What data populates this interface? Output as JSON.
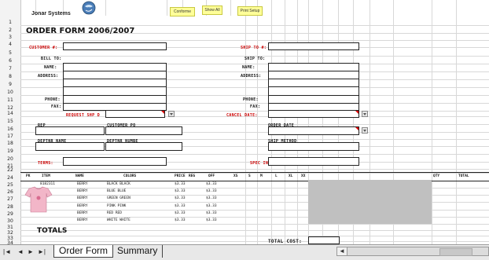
{
  "header": {
    "company": "Jonar Systems",
    "buttons": [
      "Conforme",
      "Show All",
      "Print Setup"
    ]
  },
  "title": "ORDER FORM 2006/2007",
  "row_numbers": [
    "1",
    "2",
    "3",
    "4",
    "5",
    "6",
    "7",
    "8",
    "9",
    "10",
    "11",
    "12",
    "14",
    "15",
    "16",
    "17",
    "18",
    "19",
    "20",
    "21",
    "22",
    "24",
    "25",
    "26",
    "27",
    "28",
    "29",
    "30",
    "31",
    "32",
    "33",
    "34",
    "35"
  ],
  "form": {
    "customer": "CUSTOMER #:",
    "ship_to": "SHIP TO #:",
    "bill_to": "BILL TO:",
    "ship_to2": "SHIP TO:",
    "name_left": "NAME:",
    "name_right": "NAME:",
    "address_left": "ADDRESS:",
    "address_right": "ADDRESS:",
    "phone_left": "PHONE:",
    "phone_right": "PHONE:",
    "fax_left": "FAX:",
    "fax_right": "FAX:",
    "request_ship": "REQUEST SHP D",
    "cancel_date": "CANCEL DATE:",
    "rep": "REP",
    "customer_po": "CUSTOMER PO",
    "order_date": "ORDER DATE",
    "deptnr": "DEPTNR NAME",
    "dept_num": "DEPTNR NUMBE",
    "ship_method": "SHIP METHOD",
    "terms": "TERMS:",
    "spec_inst": "SPEC INST."
  },
  "table": {
    "headers": [
      "PK",
      "ITEM",
      "NAME",
      "COLORS",
      "PRICE",
      "REG",
      "OFF",
      "XS",
      "S",
      "M",
      "L",
      "XL",
      "XX",
      "QTY",
      "TOTAL"
    ],
    "rows": [
      {
        "item": "8182311",
        "name": "BERRY",
        "color": "BLACK BLACK",
        "price": "$3.33",
        "off": "$3.33"
      },
      {
        "item": "",
        "name": "BERRY",
        "color": "BLUE BLUE",
        "price": "$3.33",
        "off": "$3.33"
      },
      {
        "item": "",
        "name": "BERRY",
        "color": "GREEN GREEN",
        "price": "$3.33",
        "off": "$3.33"
      },
      {
        "item": "",
        "name": "BERRY",
        "color": "PINK PINK",
        "price": "$3.33",
        "off": "$3.33"
      },
      {
        "item": "",
        "name": "BERRY",
        "color": "RED RED",
        "price": "$3.33",
        "off": "$3.33"
      },
      {
        "item": "",
        "name": "BERRY",
        "color": "WHITE WHITE",
        "price": "$3.33",
        "off": "$3.33"
      }
    ]
  },
  "totals": "TOTALS",
  "total_cost": "TOTAL COST:",
  "tabs": {
    "order_form": "Order Form",
    "summary": "Summary"
  },
  "nav": [
    "|◄",
    "◄",
    "►",
    "►|"
  ],
  "colors": {
    "button_yellow": "#ffff99",
    "label_red": "#cc0000",
    "gray_block": "#c0c0c0",
    "tshirt_pink": "#f2b6c8"
  }
}
